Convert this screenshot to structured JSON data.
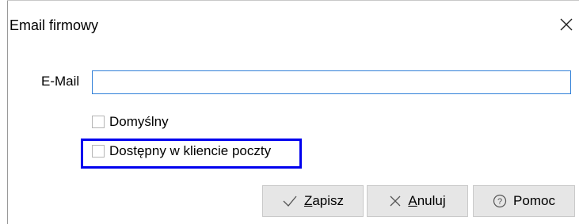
{
  "dialog": {
    "title": "Email firmowy",
    "close_icon": "close-icon"
  },
  "form": {
    "email_label": "E-Mail",
    "email_value": "",
    "default_label": "Domyślny",
    "default_checked": false,
    "client_label": "Dostępny w kliencie poczty",
    "client_checked": false
  },
  "buttons": {
    "save_first": "Z",
    "save_rest": "apisz",
    "save_icon": "check-icon",
    "cancel_first": "A",
    "cancel_rest": "nuluj",
    "cancel_icon": "x-icon",
    "help_label": "Pomoc",
    "help_icon": "question-circle-icon"
  },
  "colors": {
    "highlight": "#0000ee",
    "input_border": "#2f7fd8"
  }
}
